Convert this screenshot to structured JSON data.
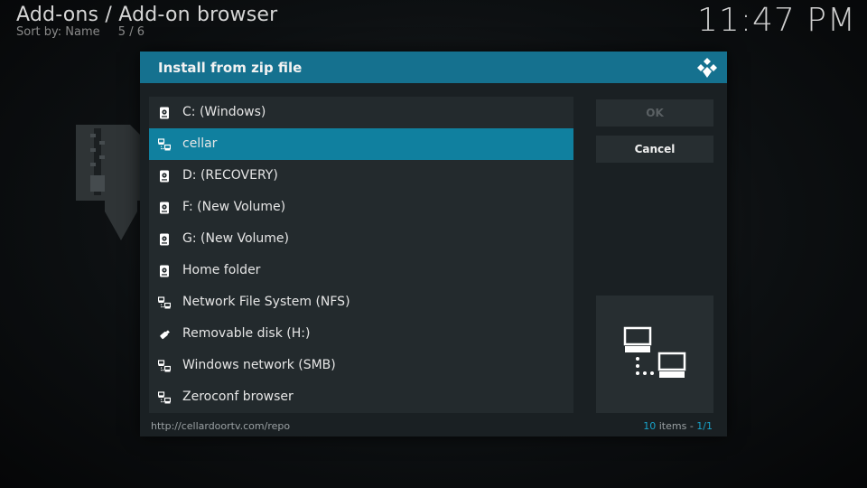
{
  "header": {
    "title": "Add-ons / Add-on browser",
    "sort_label": "Sort by: Name",
    "position": "5 / 6",
    "clock": "11:47 PM"
  },
  "dialog": {
    "title": "Install from zip file",
    "items": [
      {
        "label": "C: (Windows)",
        "icon": "hard-drive-icon",
        "selected": false
      },
      {
        "label": "cellar",
        "icon": "network-source-icon",
        "selected": true
      },
      {
        "label": "D: (RECOVERY)",
        "icon": "hard-drive-icon",
        "selected": false
      },
      {
        "label": "F: (New Volume)",
        "icon": "hard-drive-icon",
        "selected": false
      },
      {
        "label": "G: (New Volume)",
        "icon": "hard-drive-icon",
        "selected": false
      },
      {
        "label": "Home folder",
        "icon": "hard-drive-icon",
        "selected": false
      },
      {
        "label": "Network File System (NFS)",
        "icon": "network-icon",
        "selected": false
      },
      {
        "label": "Removable disk (H:)",
        "icon": "usb-drive-icon",
        "selected": false
      },
      {
        "label": "Windows network (SMB)",
        "icon": "network-icon",
        "selected": false
      },
      {
        "label": "Zeroconf browser",
        "icon": "network-icon",
        "selected": false
      }
    ],
    "ok_label": "OK",
    "cancel_label": "Cancel",
    "path": "http://cellardoortv.com/repo",
    "item_count": "10",
    "items_word": "items -",
    "page": "1/1"
  },
  "colors": {
    "header_bar": "#15718f",
    "selected_row": "#10809f",
    "accent_text": "#19a2c9"
  }
}
